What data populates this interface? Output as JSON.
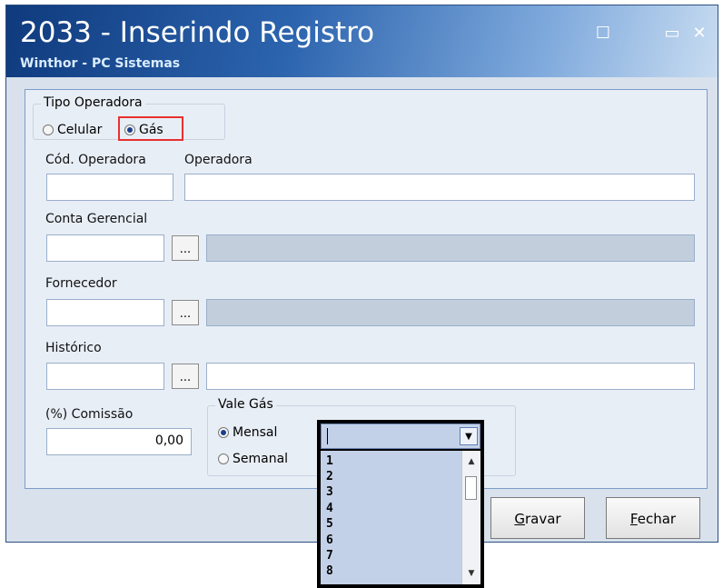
{
  "window": {
    "title": "2033 - Inserindo Registro",
    "subtitle": "Winthor - PC Sistemas",
    "maximize_glyph": "☐",
    "restore_glyph": "▭",
    "close_glyph": "✕"
  },
  "tipo_operadora": {
    "label": "Tipo Operadora",
    "options": [
      {
        "label": "Celular",
        "selected": false
      },
      {
        "label": "Gás",
        "selected": true
      }
    ]
  },
  "form": {
    "cod_operadora_label": "Cód. Operadora",
    "operadora_label": "Operadora",
    "conta_gerencial_label": "Conta Gerencial",
    "fornecedor_label": "Fornecedor",
    "historico_label": "Histórico",
    "comissao_label": "(%) Comissão",
    "comissao_value": "0,00",
    "ellipsis": "..."
  },
  "vale_gas": {
    "label": "Vale Gás",
    "options": [
      {
        "label": "Mensal",
        "selected": true
      },
      {
        "label": "Semanal",
        "selected": false
      }
    ],
    "dropdown_items": [
      "1",
      "2",
      "3",
      "4",
      "5",
      "6",
      "7",
      "8"
    ]
  },
  "buttons": {
    "gravar_prefix": "G",
    "gravar_rest": "ravar",
    "fechar_prefix": "F",
    "fechar_rest": "echar"
  },
  "colors": {
    "title_bar": "#1a4a8f",
    "highlight": "#e83030",
    "disabled_field": "#c2cedc"
  }
}
